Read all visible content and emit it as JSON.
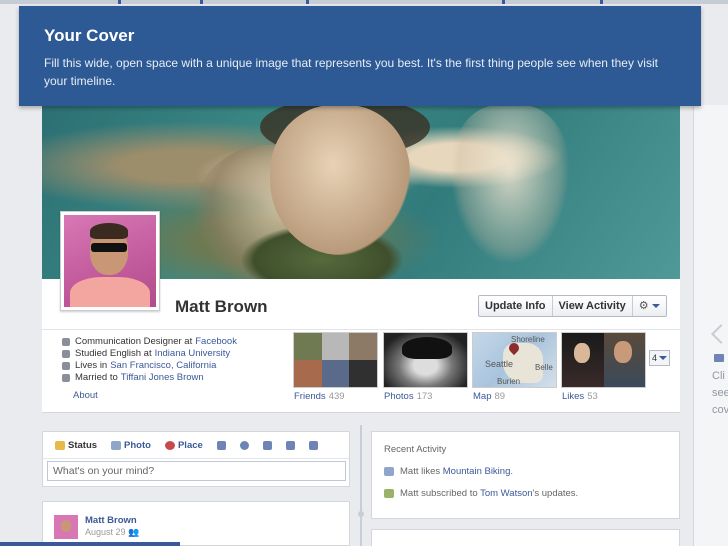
{
  "tooltip": {
    "title": "Your Cover",
    "text": "Fill this wide, open space with a unique image that represents you best. It's the first thing people see when they visit your timeline."
  },
  "profile": {
    "name": "Matt Brown",
    "update_info": "Update Info",
    "view_activity": "View Activity"
  },
  "about": {
    "items": [
      {
        "prefix": "Communication Designer at",
        "link": "Facebook",
        "icon": "briefcase-icon"
      },
      {
        "prefix": "Studied English at",
        "link": "Indiana University",
        "icon": "graduation-cap-icon"
      },
      {
        "prefix": "Lives in",
        "link": "San Francisco, California",
        "icon": "house-icon"
      },
      {
        "prefix": "Married to",
        "link": "Tiffani Jones Brown",
        "icon": "heart-icon"
      }
    ],
    "about_link": "About"
  },
  "tiles": {
    "friends": {
      "label": "Friends",
      "count": "439"
    },
    "photos": {
      "label": "Photos",
      "count": "173"
    },
    "map": {
      "label": "Map",
      "count": "89",
      "place1": "Seattle",
      "place2": "Belle",
      "place3": "Shoreline",
      "place4": "Burien"
    },
    "likes": {
      "label": "Likes",
      "count": "53"
    },
    "more": "4"
  },
  "composer": {
    "tab_status": "Status",
    "tab_photo": "Photo",
    "tab_place": "Place",
    "placeholder": "What's on your mind?"
  },
  "post": {
    "name": "Matt Brown",
    "date": "August 29"
  },
  "recent_activity": {
    "title": "Recent Activity",
    "item1_prefix": "Matt likes",
    "item1_link": "Mountain Biking",
    "item1_suffix": ".",
    "item2_prefix": "Matt subscribed to",
    "item2_link": "Tom Watson",
    "item2_suffix": "'s updates."
  },
  "right_edge": {
    "hint_lines": [
      "Cli",
      "see",
      "cov"
    ]
  },
  "colors": {
    "tooltip_bg": "#2d5a94",
    "link": "#3b5998"
  }
}
